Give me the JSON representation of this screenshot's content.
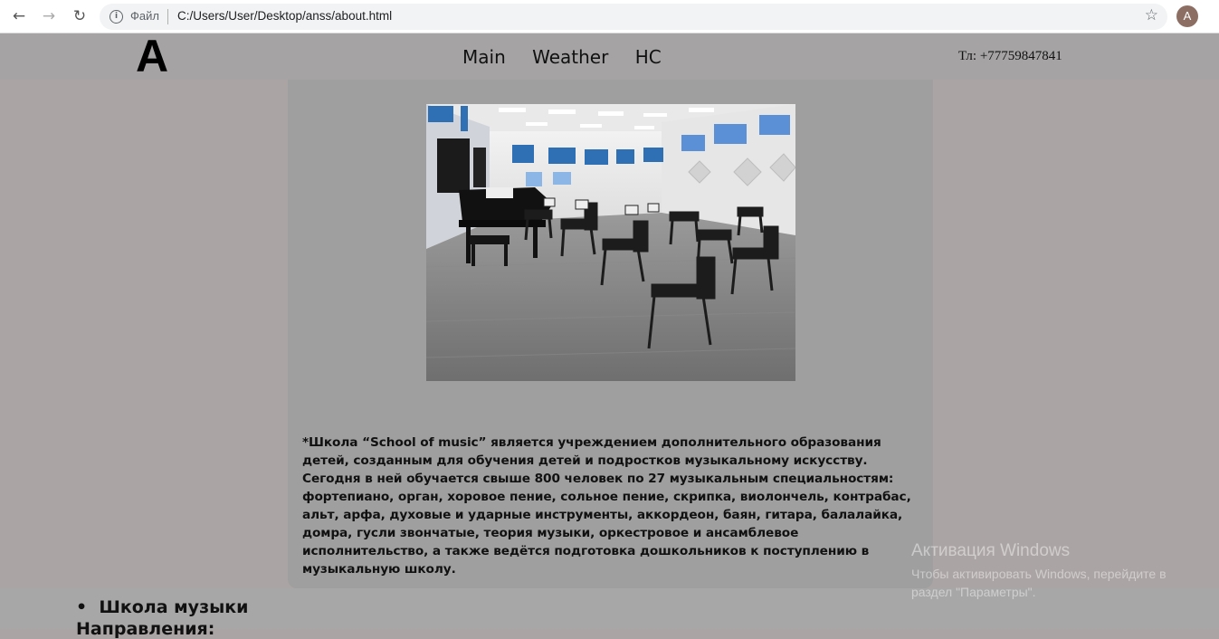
{
  "browser": {
    "file_label": "Файл",
    "url": "C:/Users/User/Desktop/anss/about.html",
    "avatar_letter": "A"
  },
  "header": {
    "logo": "A",
    "nav": [
      "Main",
      "Weather",
      "HC"
    ],
    "phone": "Тл: +77759847841"
  },
  "main": {
    "photo_alt": "music classroom with grand piano and chairs",
    "description": "*Школа “School of music” является учреждением дополнительного образования детей, созданным для обучения детей и подростков музыкальному искусству. Сегодня в ней обучается свыше 800 человек по 27 музыкальным специальностям: фортепиано, орган, хоровое пение, сольное пение, скрипка, виолончель, контрабас, альт, арфа, духовые и ударные инструменты, аккордеон, баян, гитара, балалайка, домра, гусли звончатые, теория музыки, оркестровое и ансамблевое исполнительство, а также ведётся подготовка дошкольников к поступлению в музыкальную школу."
  },
  "footer": {
    "list_item": "Школа музыки",
    "directions": "Направления:"
  },
  "windows_activation": {
    "title": "Активация Windows",
    "line1": "Чтобы активировать Windows, перейдите в",
    "line2": "раздел \"Параметры\"."
  },
  "colors": {
    "page_bg": "#aba4a4",
    "header_bg": "#a5a3a3",
    "panel_bg": "#9f9f9f"
  }
}
